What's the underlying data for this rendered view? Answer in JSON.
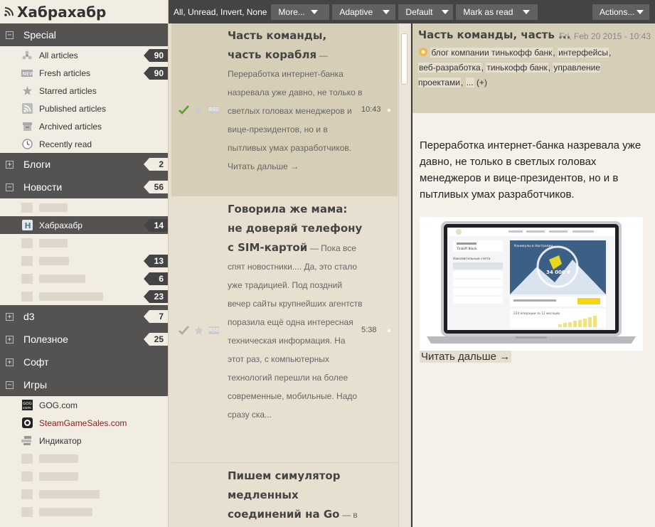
{
  "app": {
    "title": "Хабрахабр"
  },
  "sidebar": {
    "special": {
      "label": "Special",
      "items": [
        {
          "label": "All articles",
          "icon": "all-articles-icon",
          "count": "90"
        },
        {
          "label": "Fresh articles",
          "icon": "new-icon",
          "count": "90"
        },
        {
          "label": "Starred articles",
          "icon": "star-icon",
          "count": ""
        },
        {
          "label": "Published articles",
          "icon": "rss-icon",
          "count": ""
        },
        {
          "label": "Archived articles",
          "icon": "archive-icon",
          "count": ""
        },
        {
          "label": "Recently read",
          "icon": "clock-icon",
          "count": ""
        }
      ]
    },
    "blogi": {
      "label": "Блоги",
      "count": "2"
    },
    "novosti": {
      "label": "Новости",
      "count": "56",
      "selected_feed": {
        "label": "Хабрахабр",
        "count": "14"
      },
      "hidden_counts": [
        "13",
        "6",
        "23"
      ]
    },
    "d3": {
      "label": "d3",
      "count": "7"
    },
    "poleznoe": {
      "label": "Полезное",
      "count": "25"
    },
    "soft": {
      "label": "Софт"
    },
    "igry": {
      "label": "Игры",
      "feeds": [
        {
          "label": "GOG.com",
          "icon": "gog-icon"
        },
        {
          "label": "SteamGameSales.com",
          "icon": "steam-icon"
        },
        {
          "label": "Индикатор",
          "icon": "indicator-icon"
        }
      ]
    }
  },
  "toolbar": {
    "select_all": "All",
    "select_unread": "Unread",
    "select_invert": "Invert",
    "select_none": "None",
    "more": "More...",
    "view_mode": "Adaptive",
    "sort": "Default",
    "mark_as_read": "Mark as read",
    "actions": "Actions..."
  },
  "headlines": [
    {
      "title": "Часть команды, часть корабля",
      "excerpt": "— Переработка интернет-банка назревала уже давно, не только в светлых головах менеджеров и вице-президентов, но и в пытливых умах разработчиков. Читать дальше →",
      "time": "10:43",
      "published_label": "RSS"
    },
    {
      "title": "Говорила же мама: не доверяй телефону с SIM-картой",
      "excerpt": "— Пока все спят новостники.... Да, это стало уже традицией. Под поздний вечер сайты крупнейших агентств поразила ещё одна интересная техническая информация. На этот раз, с компьютерных технологий перешли на более современные, мобильные. Надо сразу ска...",
      "time": "5:38",
      "published_label": "RSS"
    },
    {
      "title": "Пишем симулятор медленных соединений на Go",
      "excerpt": "— в",
      "time": "",
      "published_label": ""
    }
  ],
  "article": {
    "title": "Часть команды, часть ...",
    "date": "Fri, Feb 20 2015 - 10:43",
    "tags": [
      "блог компании тинькофф банк",
      "интерфейсы",
      "веб-разработка",
      "тинькофф банк",
      "управление проектами",
      "..."
    ],
    "tags_more": "(+)",
    "text": "Переработка интернет-банка назревала уже давно, не только в светлых головах менеджеров и вице-президентов, но и в пытливых умах разработчиков.",
    "image": {
      "bank_header": "Каникулы в Австралии",
      "account_label": "Накопительные счета",
      "balance": "34 000 ₽",
      "card_label": "Tinkoff Black",
      "ops_label": "224 операции за 12 месяцев"
    },
    "read_more": "Читать дальше →"
  },
  "colors": {
    "dark_bar": "#444444",
    "category_bg": "#555352",
    "sidebar_bg": "#f2ede3",
    "active_headline": "#d7ceb7",
    "check_green": "#5a9e2f",
    "star": "#cccccc"
  }
}
